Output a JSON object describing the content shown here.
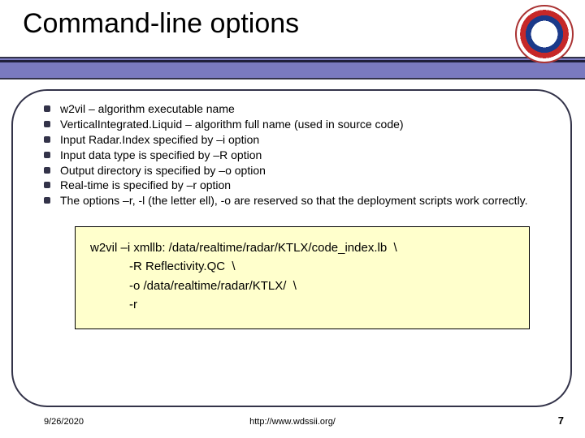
{
  "title": "Command-line options",
  "bullets": [
    "w2vil – algorithm executable name",
    "VerticalIntegrated.Liquid – algorithm full name (used in source code)",
    "Input Radar.Index specified by –i option",
    "Input data type is specified by –R option",
    "Output directory is specified by –o option",
    "Real-time is specified by –r option",
    "The options –r, -l (the letter ell), -o are reserved so that the deployment scripts work correctly."
  ],
  "code": {
    "l1": "w2vil –i xmllb: /data/realtime/radar/KTLX/code_index.lb  \\",
    "l2": "-R Reflectivity.QC  \\",
    "l3": "-o /data/realtime/radar/KTLX/  \\",
    "l4": "-r"
  },
  "footer": {
    "date": "9/26/2020",
    "url": "http://www.wdssii.org/",
    "page": "7"
  }
}
